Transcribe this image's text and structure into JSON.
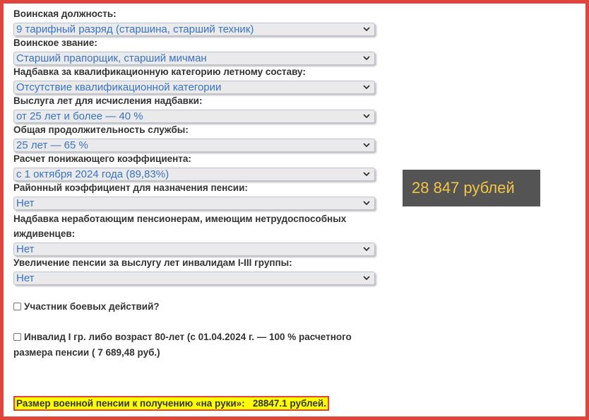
{
  "fields": [
    {
      "label": "Воинская должность:",
      "value": "9 тарифный разряд (старшина, старший техник)"
    },
    {
      "label": "Воинское звание:",
      "value": "Старший прапорщик, старший мичман"
    },
    {
      "label": "Надбавка за квалификационную категорию летному составу:",
      "value": "Отсутствие квалификационной категории"
    },
    {
      "label": "Выслуга лет для исчисления надбавки:",
      "value": "от 25 лет и более — 40 %"
    },
    {
      "label": "Общая продолжительность службы:",
      "value": "25 лет — 65 %"
    },
    {
      "label": "Расчет понижающего коэффициента:",
      "value": "с 1 октября 2024 года (89,83%)"
    },
    {
      "label": "Районный коэффициент для назначения пенсии:",
      "value": "Нет"
    },
    {
      "label": "Надбавка неработающим пенсионерам, имеющим нетрудоспособных иждивенцев:",
      "value": "Нет"
    },
    {
      "label": "Увеличение пенсии за выслугу лет инвалидам I-III группы:",
      "value": "Нет"
    }
  ],
  "checkboxes": [
    {
      "label": "Участник боевых действий?"
    },
    {
      "label": "Инвалид I гр. либо возраст 80-лет (с 01.04.2024 г. — 100 % расчетного размера пенсии ( 7 689,48 руб.)"
    }
  ],
  "result_text": "Размер военной пенсии к получению «на руки»:   28847.1 рублей.",
  "badge_text": "28 847 рублей",
  "colors": {
    "frame": "#e0443a",
    "select_text": "#3a72c6",
    "highlight": "#ffff00",
    "badge_bg": "#545454",
    "badge_text": "#f4c542"
  },
  "icons": {
    "select_arrow": "chevron-down-icon"
  }
}
